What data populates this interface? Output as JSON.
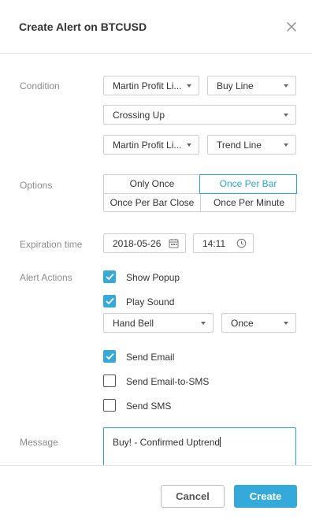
{
  "dialog": {
    "title": "Create Alert on BTCUSD",
    "close_icon": "close-icon"
  },
  "condition": {
    "label": "Condition",
    "row1": {
      "left": "Martin Profit Li...",
      "right": "Buy Line"
    },
    "row2": {
      "value": "Crossing Up"
    },
    "row3": {
      "left": "Martin Profit Li...",
      "right": "Trend Line"
    }
  },
  "options": {
    "label": "Options",
    "items": [
      "Only Once",
      "Once Per Bar",
      "Once Per Bar Close",
      "Once Per Minute"
    ],
    "selected": "Once Per Bar"
  },
  "expiration": {
    "label": "Expiration time",
    "date": "2018-05-26",
    "time": "14:11",
    "date_icon": "calendar-icon",
    "time_icon": "clock-icon"
  },
  "actions": {
    "label": "Alert Actions",
    "show_popup": {
      "label": "Show Popup",
      "checked": true
    },
    "play_sound": {
      "label": "Play Sound",
      "checked": true
    },
    "sound": "Hand Bell",
    "repeat": "Once",
    "send_email": {
      "label": "Send Email",
      "checked": true
    },
    "send_email_sms": {
      "label": "Send Email-to-SMS",
      "checked": false
    },
    "send_sms": {
      "label": "Send SMS",
      "checked": false
    }
  },
  "message": {
    "label": "Message",
    "value": "Buy! - Confirmed Uptrend"
  },
  "footer": {
    "cancel_label": "Cancel",
    "create_label": "Create"
  },
  "colors": {
    "accent": "#35a9d9",
    "border": "#cfcfcf",
    "label": "#8c8c8c"
  }
}
